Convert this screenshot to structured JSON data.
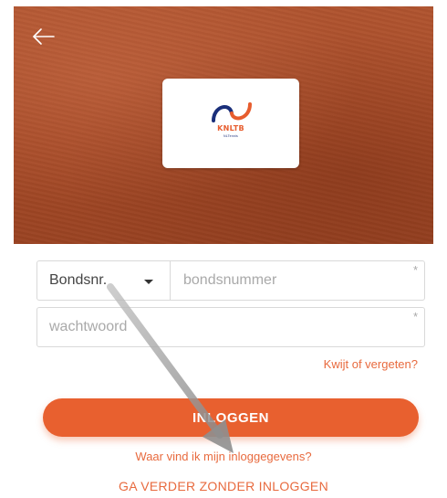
{
  "header": {
    "back_icon": "arrow-left-icon"
  },
  "logo": {
    "brand_text": "KNLTB",
    "sub_text": "NLTennis"
  },
  "form": {
    "id_type_selected": "Bondsnr.",
    "member_number_placeholder": "bondsnummer",
    "password_placeholder": "wachtwoord",
    "required_mark": "*",
    "forgot_link": "Kwijt of vergeten?",
    "login_button": "INLOGGEN"
  },
  "links": {
    "where_credentials": "Waar vind ik mijn inloggegevens?",
    "continue_without_login": "GA VERDER ZONDER INLOGGEN"
  },
  "colors": {
    "accent": "#e8602f",
    "clay": "#a64a27",
    "brand_blue": "#1a2f7a"
  }
}
